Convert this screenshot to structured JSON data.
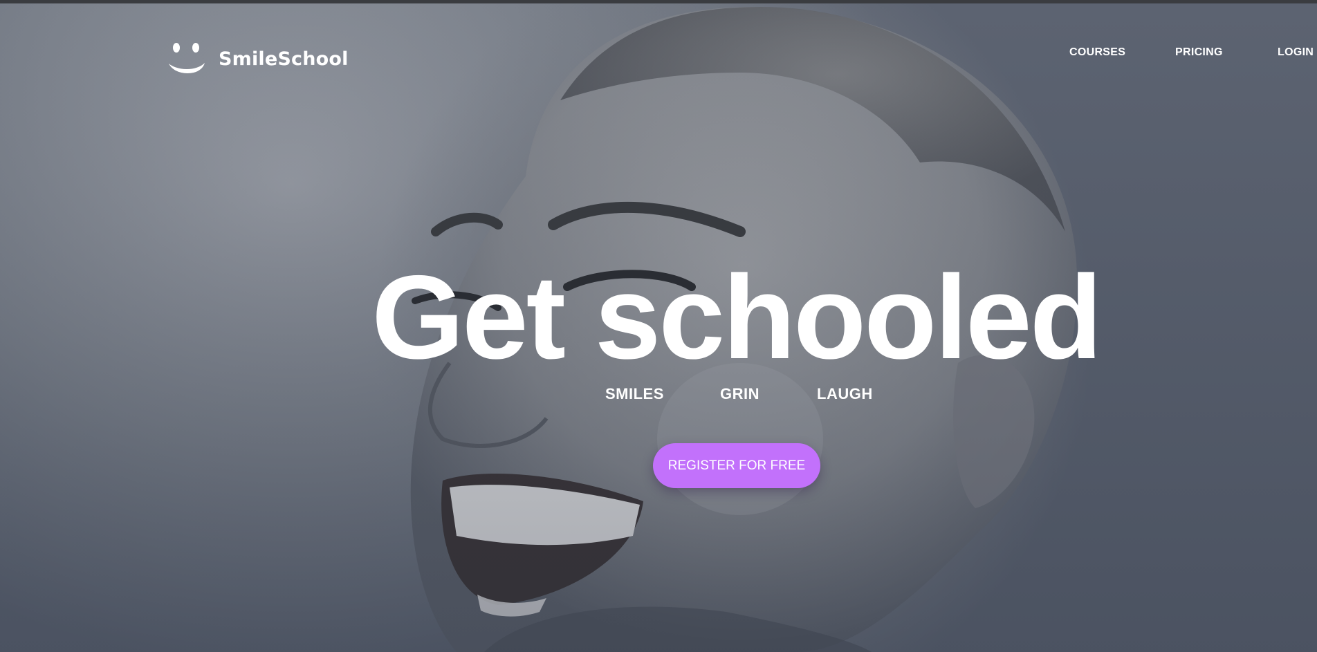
{
  "brand": {
    "name": "SmileSchool",
    "logo_icon": "smiley-face-icon"
  },
  "nav": {
    "links": [
      {
        "label": "COURSES"
      },
      {
        "label": "PRICING"
      },
      {
        "label": "LOGIN"
      }
    ]
  },
  "hero": {
    "headline": "Get schooled",
    "tags": [
      "SMILES",
      "GRIN",
      "LAUGH"
    ],
    "cta_label": "REGISTER FOR FREE",
    "background_image": "grayscale photo of smiling woman"
  },
  "colors": {
    "accent": "#c271fb",
    "text": "#ffffff",
    "topbar": "#3a3c40"
  }
}
